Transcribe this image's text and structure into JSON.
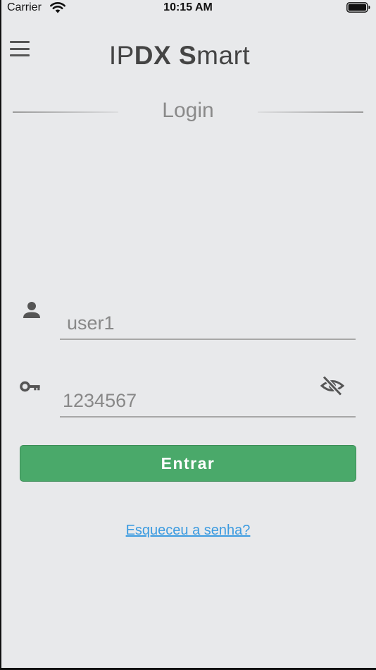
{
  "status_bar": {
    "carrier": "Carrier",
    "time": "10:15 AM"
  },
  "header": {
    "title_parts": [
      "IP",
      "DX",
      " ",
      "S",
      "mart"
    ],
    "menu_icon": "hamburger-menu-icon"
  },
  "login": {
    "section_title": "Login",
    "username_value": "user1",
    "password_value": "1234567",
    "user_icon": "person-icon",
    "password_icon": "key-icon",
    "toggle_icon": "eye-off-icon",
    "submit_label": "Entrar",
    "forgot_label": "Esqueceu a senha?"
  },
  "colors": {
    "background": "#e8e9eb",
    "button": "#4aa96a",
    "link": "#3c9be0",
    "title_text": "#444444",
    "muted_text": "#8a8a8a"
  }
}
